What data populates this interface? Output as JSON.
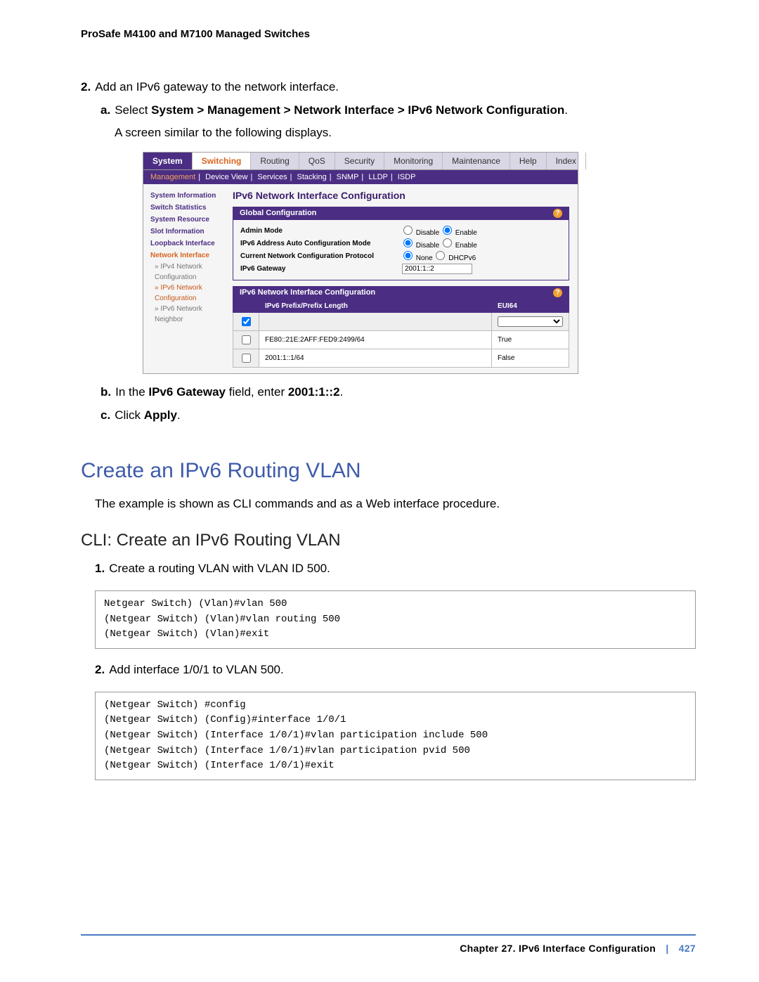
{
  "header": {
    "title": "ProSafe M4100 and M7100 Managed Switches"
  },
  "step2": {
    "num": "2.",
    "text": "Add an IPv6 gateway to the network interface.",
    "a": {
      "letter": "a.",
      "prefix": "Select ",
      "path": "System > Management > Network Interface > IPv6 Network Configuration",
      "suffix": "."
    },
    "intro": "A screen similar to the following displays.",
    "b": {
      "letter": "b.",
      "t1": "In the ",
      "f1": "IPv6 Gateway",
      "t2": " field, enter ",
      "f2": "2001:1::2",
      "t3": "."
    },
    "c": {
      "letter": "c.",
      "t1": "Click ",
      "f1": "Apply",
      "t2": "."
    }
  },
  "ui": {
    "tabs": [
      "System",
      "Switching",
      "Routing",
      "QoS",
      "Security",
      "Monitoring",
      "Maintenance",
      "Help",
      "Index"
    ],
    "subnav": [
      "Management",
      "Device View",
      "Services",
      "Stacking",
      "SNMP",
      "LLDP",
      "ISDP"
    ],
    "sidebar": [
      {
        "label": "System Information",
        "cls": "item ex"
      },
      {
        "label": "Switch Statistics",
        "cls": "item ex"
      },
      {
        "label": "System Resource",
        "cls": "item ex"
      },
      {
        "label": "Slot Information",
        "cls": "item ex"
      },
      {
        "label": "Loopback Interface",
        "cls": "item ex"
      },
      {
        "label": "Network Interface",
        "cls": "item sel"
      },
      {
        "label": "» IPv4 Network Configuration",
        "cls": "subh"
      },
      {
        "label": "» IPv6 Network Configuration",
        "cls": "subh sel"
      },
      {
        "label": "» IPv6 Network Neighbor",
        "cls": "subh"
      }
    ],
    "panel_title": "IPv6 Network Interface Configuration",
    "global": {
      "title": "Global Configuration",
      "rows": {
        "admin": {
          "label": "Admin Mode",
          "opt1": "Disable",
          "opt2": "Enable",
          "checked": 1
        },
        "auto": {
          "label": "IPv6 Address Auto Configuration Mode",
          "opt1": "Disable",
          "opt2": "Enable",
          "checked": 0
        },
        "proto": {
          "label": "Current Network Configuration Protocol",
          "opt1": "None",
          "opt2": "DHCPv6",
          "checked": 0
        },
        "gw": {
          "label": "IPv6 Gateway",
          "value": "2001:1::2"
        }
      }
    },
    "table": {
      "title": "IPv6 Network Interface Configuration",
      "col1": "IPv6 Prefix/Prefix Length",
      "col2": "EUI64",
      "rows": [
        {
          "prefix": "FE80::21E:2AFF:FED9:2499/64",
          "eui": "True"
        },
        {
          "prefix": "2001:1::1/64",
          "eui": "False"
        }
      ]
    }
  },
  "h1": "Create an IPv6 Routing VLAN",
  "p_intro": "The example is shown as CLI commands and as a Web interface procedure.",
  "h2": "CLI: Create an IPv6 Routing VLAN",
  "cli1": {
    "num": "1.",
    "text": "Create a routing VLAN with VLAN ID 500."
  },
  "code1": "Netgear Switch) (Vlan)#vlan 500\n(Netgear Switch) (Vlan)#vlan routing 500\n(Netgear Switch) (Vlan)#exit",
  "cli2": {
    "num": "2.",
    "text": "Add interface 1/0/1 to VLAN 500."
  },
  "code2": "(Netgear Switch) #config\n(Netgear Switch) (Config)#interface 1/0/1\n(Netgear Switch) (Interface 1/0/1)#vlan participation include 500\n(Netgear Switch) (Interface 1/0/1)#vlan participation pvid 500\n(Netgear Switch) (Interface 1/0/1)#exit",
  "footer": {
    "chapter": "Chapter 27.  IPv6 Interface Configuration",
    "page": "427"
  }
}
